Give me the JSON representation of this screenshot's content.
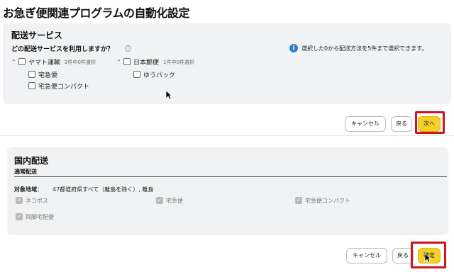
{
  "page_title": "お急ぎ便関連プログラムの自動化設定",
  "shipping_service": {
    "title": "配送サービス",
    "question": "どの配送サービスを利用しますか？",
    "note": "選択した0から配送方法を5件まで選択できます。",
    "carriers": [
      {
        "name": "ヤマト運輸",
        "count": "2件中0件選択",
        "options": [
          "宅急便",
          "宅急便コンパクト"
        ]
      },
      {
        "name": "日本郵便",
        "count": "1件中0件選択",
        "options": [
          "ゆうパック"
        ]
      }
    ]
  },
  "footer1": {
    "cancel": "キャンセル",
    "back": "戻る",
    "next": "次へ"
  },
  "domestic": {
    "title": "国内配送",
    "subtitle": "通常配送",
    "area_label": "対象地域：",
    "area_value": "47都道府県すべて（離島を除く）, 離島",
    "methods": [
      "ネコポス",
      "宅急便",
      "宅急便コンパクト",
      "飛脚宅配便"
    ]
  },
  "footer2": {
    "cancel": "キャンセル",
    "back": "戻る",
    "confirm": "確定"
  }
}
